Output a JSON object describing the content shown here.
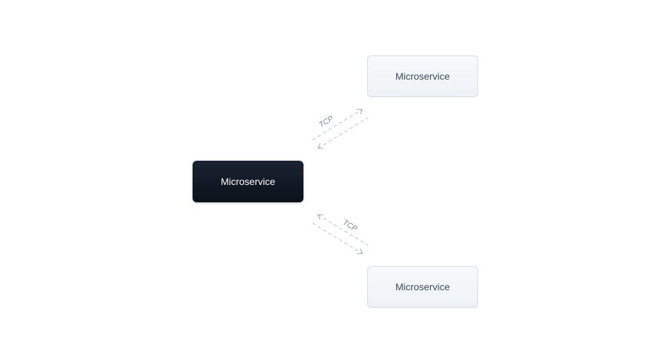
{
  "nodes": {
    "left": {
      "label": "Microservice"
    },
    "topRight": {
      "label": "Microservice"
    },
    "bottomRight": {
      "label": "Microservice"
    }
  },
  "edges": {
    "top": {
      "label": "TCP"
    },
    "bottom": {
      "label": "TCP"
    }
  },
  "colors": {
    "darkNodeBg": "#0f1620",
    "lightNodeBg": "#f2f5f8",
    "edgeStroke": "#b8c0cc",
    "labelColor": "#7a8699"
  }
}
